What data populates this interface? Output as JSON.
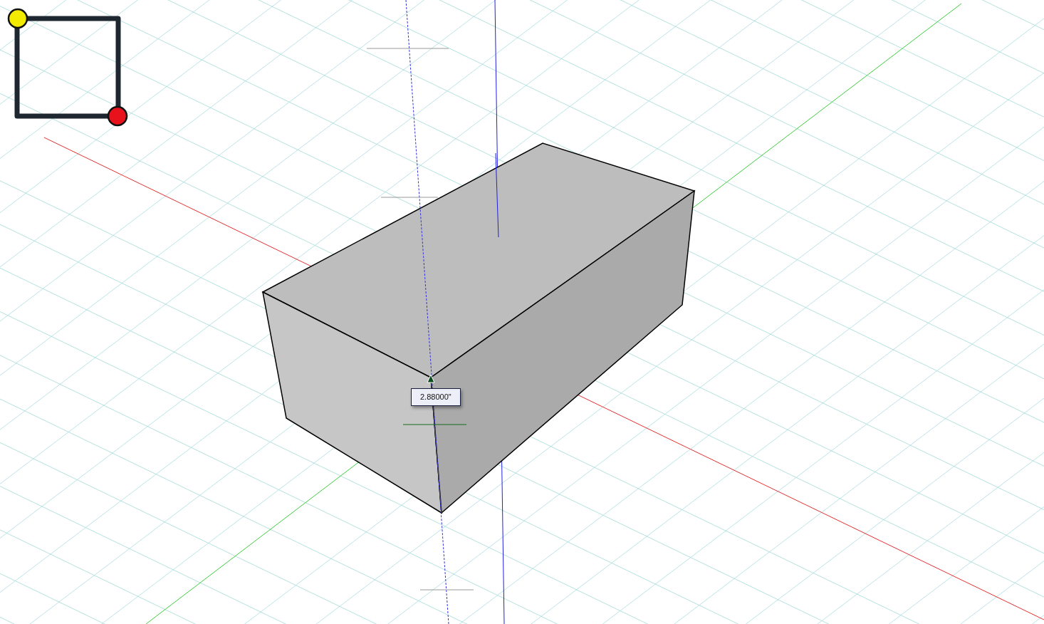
{
  "viewport": {
    "measurement_tooltip": "2.88000\""
  }
}
